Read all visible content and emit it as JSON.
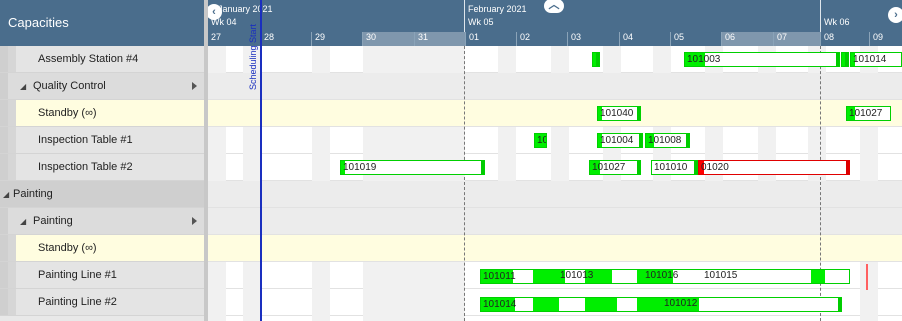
{
  "left_panel": {
    "header": "Capacities",
    "rows": [
      {
        "label": "Assembly Station #4"
      },
      {
        "label": "Quality Control"
      },
      {
        "label": "Standby (∞)"
      },
      {
        "label": "Inspection Table #1"
      },
      {
        "label": "Inspection Table #2"
      },
      {
        "label": "Painting"
      },
      {
        "label": "Painting"
      },
      {
        "label": "Standby (∞)"
      },
      {
        "label": "Painting Line #1"
      },
      {
        "label": "Painting Line #2"
      }
    ]
  },
  "timeline": {
    "months": [
      "January 2021",
      "February 2021"
    ],
    "weeks": [
      "Wk 04",
      "Wk 05",
      "Wk 06"
    ],
    "days": [
      "27",
      "28",
      "29",
      "30",
      "31",
      "01",
      "02",
      "03",
      "04",
      "05",
      "06",
      "07",
      "08",
      "09"
    ],
    "scheduling_start": "Scheduling Start"
  },
  "tasks": {
    "t_101003": "101003",
    "t_101014": "101014",
    "t_101040": "101040",
    "t_101027a": "101027",
    "t_101004": "101004",
    "t_101008": "101008",
    "t_10": "10",
    "t_101019": "101019",
    "t_101027b": "101027",
    "t_101010": "101010",
    "t_101020": "01020",
    "t_101011": "101011",
    "t_101013": "101013",
    "t_101016": "101016",
    "t_101015": "101015",
    "t_101014b": "101014",
    "t_101012": "101012"
  },
  "colors": {
    "header": "#4a6d8c",
    "task_green": "#00ee00",
    "task_red": "#ff0000",
    "standby": "#fffde0",
    "scheduling_line": "#1a2fbf"
  }
}
